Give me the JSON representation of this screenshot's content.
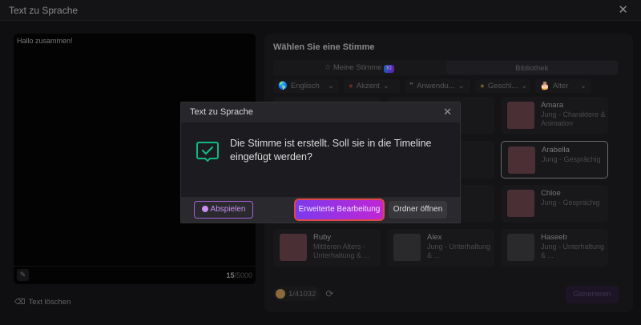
{
  "window": {
    "title": "Text zu Sprache",
    "close": "✕"
  },
  "editor": {
    "text": "Hallo zusammen!",
    "count_current": "15",
    "count_max": "/5000",
    "clear_label": "Text löschen"
  },
  "voices": {
    "heading": "Wählen Sie eine Stimme",
    "tabs": [
      {
        "label": "Meine Stimme",
        "badge": "KI"
      },
      {
        "label": "Bibliothek",
        "active": true
      }
    ],
    "filters": [
      {
        "icon": "globe-icon",
        "label": "Englisch"
      },
      {
        "icon": "lips-icon",
        "label": "Akzent"
      },
      {
        "icon": "quote-icon",
        "label": "Anwendu..."
      },
      {
        "icon": "gender-icon",
        "label": "Geschl..."
      },
      {
        "icon": "cake-icon",
        "label": "Alter"
      }
    ],
    "cards": [
      {
        "name": "",
        "desc": ""
      },
      {
        "name": "",
        "desc": ""
      },
      {
        "name": "Amara",
        "desc": "Jung - Charaktere & Animation"
      },
      {
        "name": "",
        "desc": ""
      },
      {
        "name": "",
        "desc": ""
      },
      {
        "name": "Arabella",
        "desc": "Jung - Gesprächig",
        "selected": true
      },
      {
        "name": "",
        "desc": ""
      },
      {
        "name": "",
        "desc": ""
      },
      {
        "name": "Chloe",
        "desc": "Jung - Gesprächig"
      },
      {
        "name": "Ruby",
        "desc": "Mittleren Alters - Unterhaltung & ..."
      },
      {
        "name": "Alex",
        "desc": "Jung - Unterhaltung & ..."
      },
      {
        "name": "Haseeb",
        "desc": "Jung - Unterhaltung & ..."
      }
    ],
    "credits": "1/41032",
    "generate_label": "Generieren"
  },
  "dialog": {
    "title": "Text zu Sprache",
    "close": "✕",
    "message": "Die Stimme ist erstellt. Soll sie in die Timeline eingefügt werden?",
    "play_label": "Abspielen",
    "advanced_label": "Erweiterte Bearbeitung",
    "open_folder_label": "Ordner öffnen",
    "accent": "#10b981"
  }
}
